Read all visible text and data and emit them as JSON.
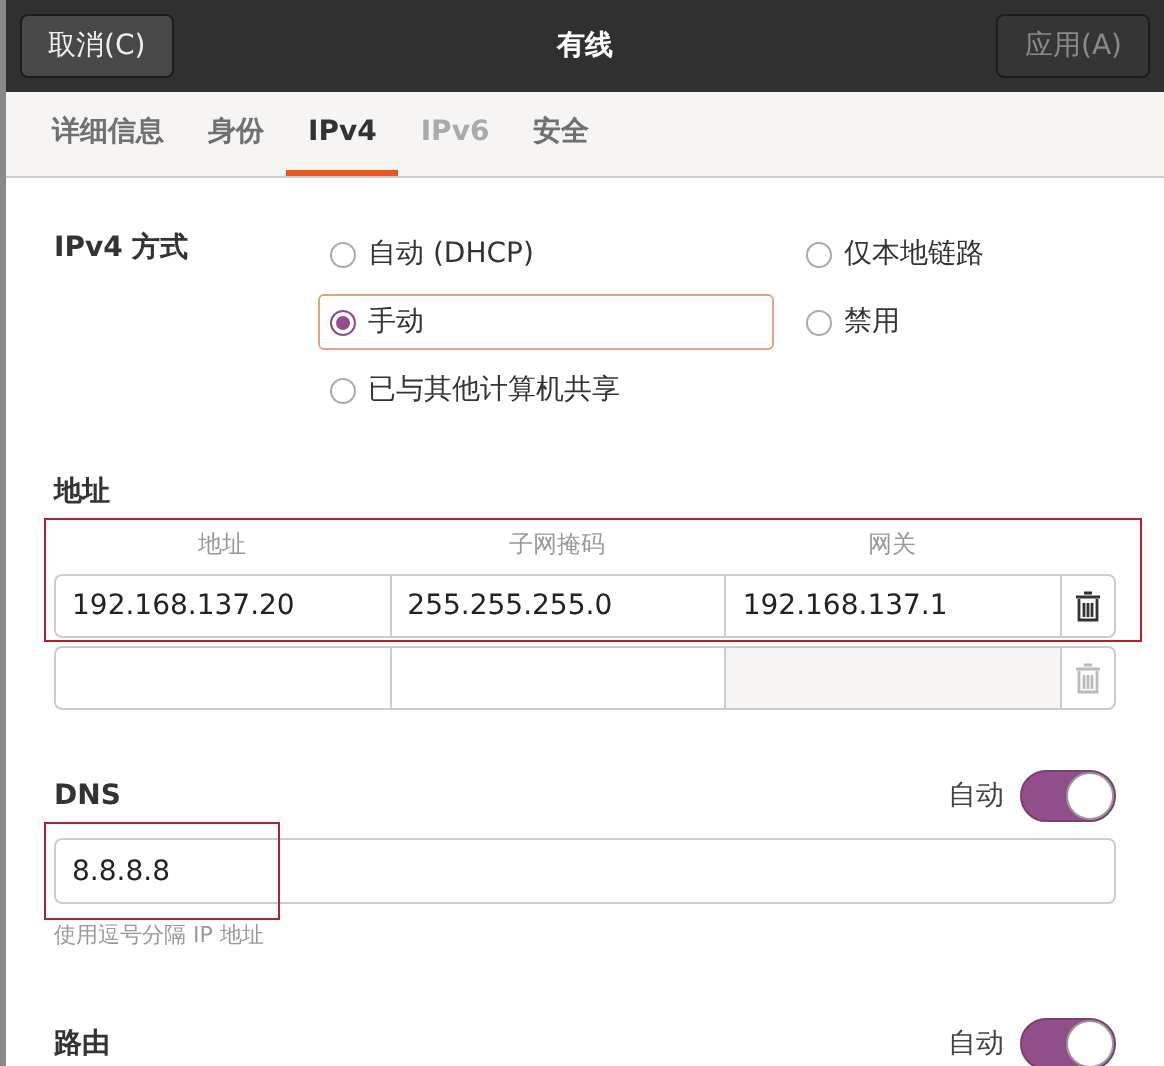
{
  "header": {
    "cancel_button": "取消(C)",
    "title": "有线",
    "apply_button": "应用(A)",
    "apply_disabled": true
  },
  "tabs": [
    {
      "label": "详细信息",
      "selected": false,
      "disabled": false
    },
    {
      "label": "身份",
      "selected": false,
      "disabled": false
    },
    {
      "label": "IPv4",
      "selected": true,
      "disabled": false
    },
    {
      "label": "IPv6",
      "selected": false,
      "disabled": true
    },
    {
      "label": "安全",
      "selected": false,
      "disabled": false
    }
  ],
  "method": {
    "label": "IPv4 方式",
    "options": [
      {
        "label": "自动 (DHCP)",
        "selected": false,
        "focused": false
      },
      {
        "label": "仅本地链路",
        "selected": false,
        "focused": false
      },
      {
        "label": "手动",
        "selected": true,
        "focused": true
      },
      {
        "label": "禁用",
        "selected": false,
        "focused": false
      },
      {
        "label": "已与其他计算机共享",
        "selected": false,
        "focused": false
      }
    ]
  },
  "addresses": {
    "heading": "地址",
    "annotated": true,
    "columns": [
      "地址",
      "子网掩码",
      "网关"
    ],
    "rows": [
      {
        "cells": [
          "192.168.137.20",
          "255.255.255.0",
          "192.168.137.1"
        ],
        "delete_enabled": true
      },
      {
        "cells": [
          "",
          "",
          ""
        ],
        "delete_enabled": false
      }
    ]
  },
  "dns": {
    "heading": "DNS",
    "auto_label": "自动",
    "auto": true,
    "value": "8.8.8.8",
    "annotated": true,
    "hint": "使用逗号分隔 IP 地址"
  },
  "routes": {
    "heading": "路由",
    "auto_label": "自动",
    "auto": true
  }
}
